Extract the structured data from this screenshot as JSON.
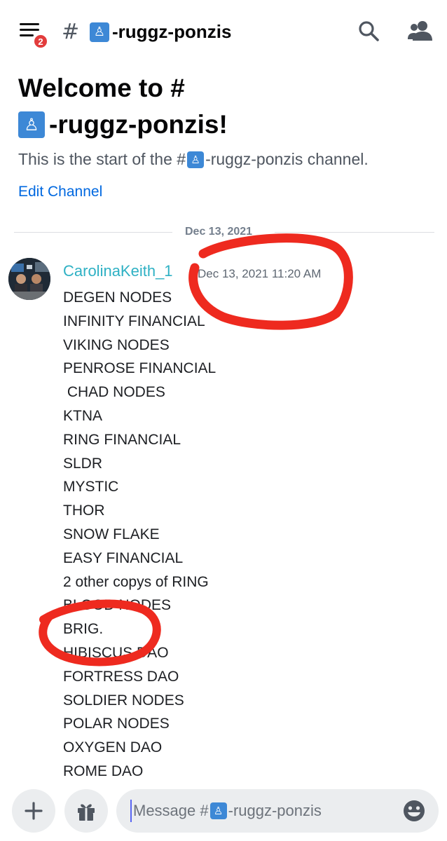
{
  "header": {
    "notification_count": "2",
    "channel_name": "-ruggz-ponzis"
  },
  "welcome": {
    "title_line1": "Welcome to #",
    "title_line2": "-ruggz-ponzis!",
    "subtitle_before": "This is the start of the #",
    "subtitle_after": "-ruggz-ponzis channel.",
    "edit_link": "Edit Channel"
  },
  "divider": {
    "date": "Dec 13, 2021"
  },
  "message": {
    "author": "CarolinaKeith_1",
    "timestamp": "Dec 13, 2021 11:20 AM",
    "lines": [
      "DEGEN NODES",
      "INFINITY FINANCIAL",
      "VIKING NODES",
      "PENROSE FINANCIAL",
      " CHAD NODES",
      "KTNA",
      "RING FINANCIAL",
      "SLDR",
      "MYSTIC",
      "THOR",
      "SNOW FLAKE",
      "EASY FINANCIAL",
      "2 other copys of RING",
      "BLOOD NODES",
      "BRIG.",
      "HIBISCUS DAO",
      "FORTRESS DAO",
      "SOLDIER NODES",
      "POLAR NODES",
      "OXYGEN DAO",
      "ROME DAO"
    ]
  },
  "composer": {
    "placeholder_before": "Message #",
    "placeholder_after": "-ruggz-ponzis"
  },
  "colors": {
    "accent_link": "#0068e0",
    "username": "#2fb1c4",
    "badge": "#e23c3c",
    "annotation": "#ee2a1f",
    "channel_emoji": "#3d88d6"
  },
  "icons": {
    "menu": "hamburger-menu-icon",
    "hash": "hash-icon",
    "channel_emoji": "put-litter-in-its-place-icon",
    "search": "search-icon",
    "members": "members-icon",
    "plus": "plus-icon",
    "gift": "gift-icon",
    "emoji": "emoji-icon"
  }
}
